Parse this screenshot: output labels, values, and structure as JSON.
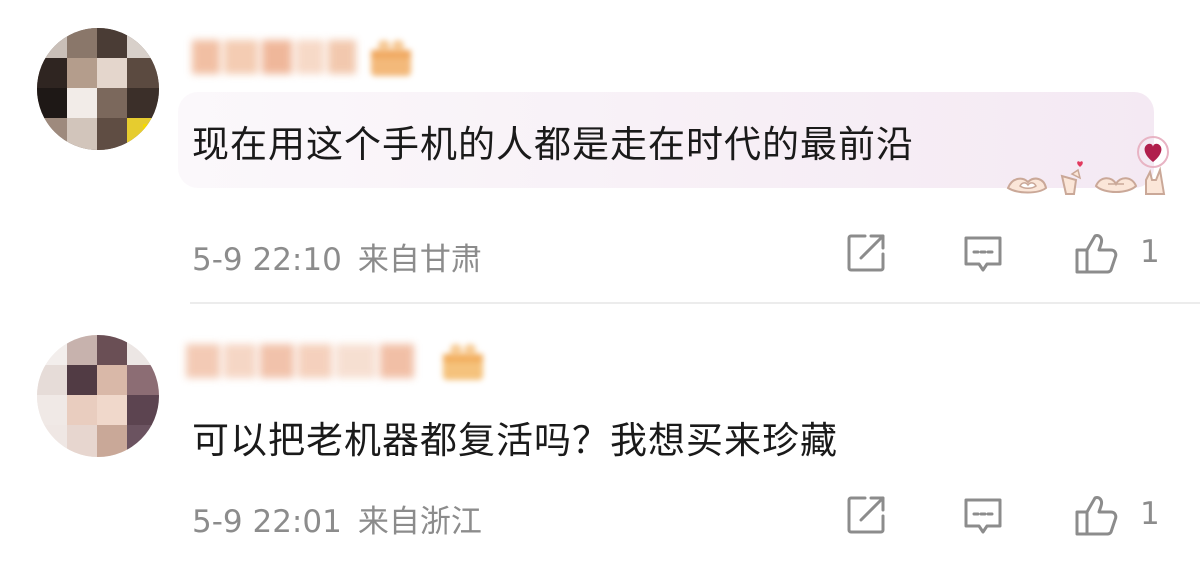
{
  "comments": [
    {
      "text": "现在用这个手机的人都是走在时代的最前沿",
      "time": "5-9 22:10",
      "location": "来自甘肃",
      "likes": "1",
      "avatar_icon": "avatar-blurred",
      "badge_icon": "gift-badge-icon",
      "bubble_decoration": "heart-hand-gestures"
    },
    {
      "text": "可以把老机器都复活吗？我想买来珍藏",
      "time": "5-9 22:01",
      "location": "来自浙江",
      "likes": "1",
      "avatar_icon": "avatar-blurred",
      "badge_icon": "gift-badge-icon"
    }
  ],
  "actions": {
    "share_icon": "share-icon",
    "reply_icon": "reply-icon",
    "like_icon": "thumbs-up-icon"
  },
  "colors": {
    "text": "#1a1a1a",
    "meta": "#8c8c8c",
    "divider": "#ececec",
    "bubble": "#f7eff6"
  }
}
